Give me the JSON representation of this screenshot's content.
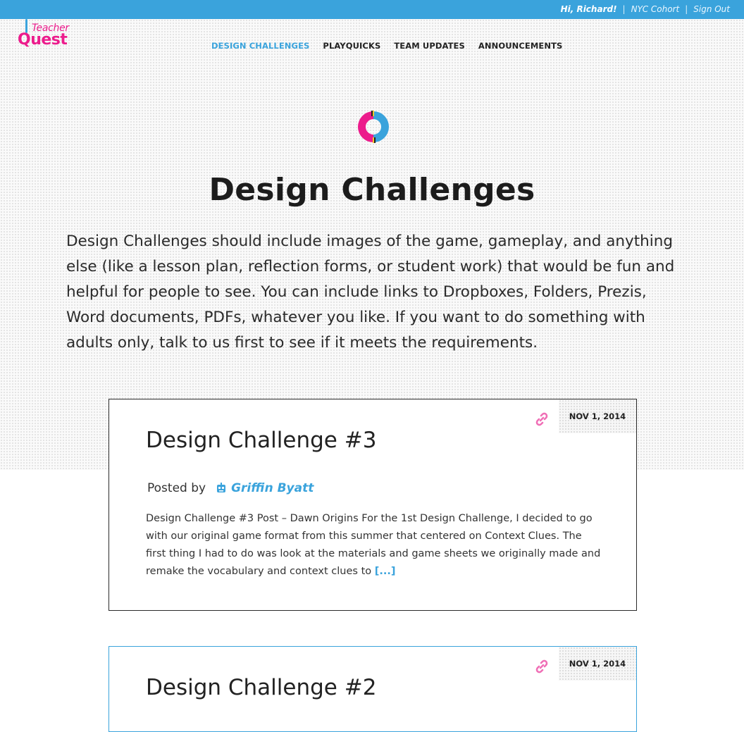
{
  "topbar": {
    "greeting": "Hi, Richard!",
    "cohort": "NYC Cohort",
    "sign_out": "Sign Out",
    "separator": "|"
  },
  "logo": {
    "line1": "Teacher",
    "line2": "Quest"
  },
  "nav": {
    "items": [
      {
        "label": "DESIGN CHALLENGES",
        "active": true
      },
      {
        "label": "PLAYQUICKS",
        "active": false
      },
      {
        "label": "TEAM UPDATES",
        "active": false
      },
      {
        "label": "ANNOUNCEMENTS",
        "active": false
      }
    ]
  },
  "page": {
    "title": "Design Challenges",
    "intro": "Design Challenges should include images of the game, gameplay, and anything else (like a lesson plan, reflection forms, or student work) that would be fun and helpful for people to see. You can include links to Dropboxes, Folders, Prezis, Word documents, PDFs, whatever you like. If you want to do something with adults only, talk to us first to see if it meets the requirements."
  },
  "posts": [
    {
      "date": "NOV 1, 2014",
      "title": "Design Challenge #3",
      "posted_by_label": "Posted by",
      "author": "Griffin Byatt",
      "excerpt": "Design Challenge #3 Post – Dawn Origins For the 1st Design Challenge, I decided to go with our original game format from this summer that centered on Context Clues. The first thing I had to do was look at the materials and game sheets we originally made and remake the vocabulary and context clues to",
      "more": "[...]"
    },
    {
      "date": "NOV 1, 2014",
      "title": "Design Challenge #2"
    }
  ],
  "colors": {
    "accent": "#3aa3dc",
    "brand_pink": "#ec1c8c",
    "link_icon": "#f06fb6"
  },
  "icons": {
    "hero": "design-challenge-icon",
    "link": "link-icon",
    "author": "robot-avatar-icon"
  }
}
